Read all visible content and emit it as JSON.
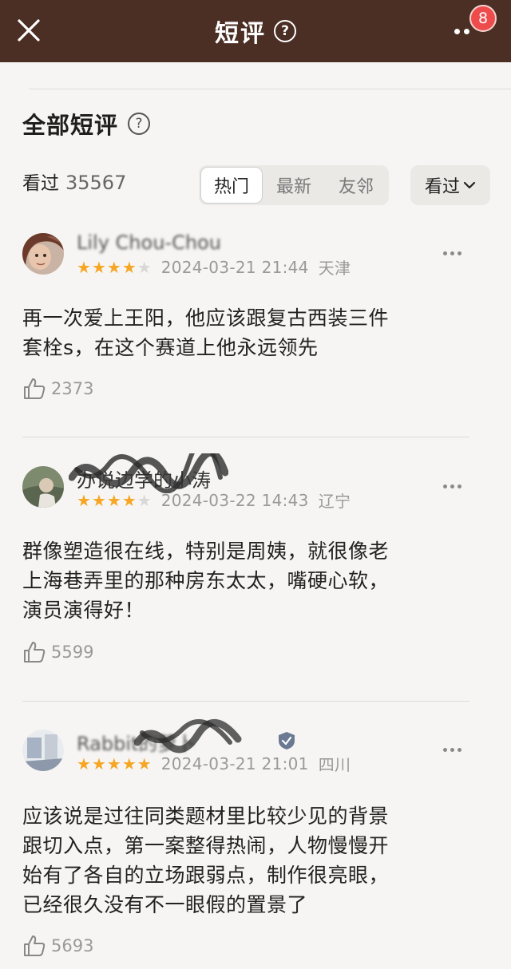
{
  "header": {
    "title": "短评",
    "help_glyph": "?",
    "badge_count": "8",
    "background": "#4b2e24"
  },
  "section": {
    "title": "全部短评",
    "help_glyph": "?",
    "count_label": "看过",
    "count_value": "35567"
  },
  "tabs": [
    {
      "label": "热门",
      "active": true
    },
    {
      "label": "最新",
      "active": false
    },
    {
      "label": "友邻",
      "active": false
    }
  ],
  "filter": {
    "label": "看过"
  },
  "reviews": [
    {
      "user": "Lily Chou-Chou",
      "rating": 4,
      "date": "2024-03-21 21:44",
      "location": "天津",
      "text_lines": [
        "再一次爱上王阳，他应该跟复古西装三件",
        "套栓s，在这个赛道上他永远领先"
      ],
      "likes": "2373"
    },
    {
      "user": "办说边学的小涛",
      "rating": 4,
      "date": "2024-03-22 14:43",
      "location": "辽宁",
      "text_lines": [
        "群像塑造很在线，特别是周姨，就很像老",
        "上海巷弄里的那种房东太太，嘴硬心软，",
        "演员演得好！"
      ],
      "likes": "5599"
    },
    {
      "user": "Rabbit的萝卜",
      "rating": 5,
      "date": "2024-03-21 21:01",
      "location": "四川",
      "text_lines": [
        "应该说是过往同类题材里比较少见的背景",
        "跟切入点，第一案整得热闹，人物慢慢开",
        "始有了各自的立场跟弱点，制作很亮眼，",
        "已经很久没有不一眼假的置景了"
      ],
      "likes": "5693"
    }
  ],
  "colors": {
    "star_on": "#f6a623",
    "star_off": "#d8d8d8",
    "badge": "#ee4c4c"
  }
}
